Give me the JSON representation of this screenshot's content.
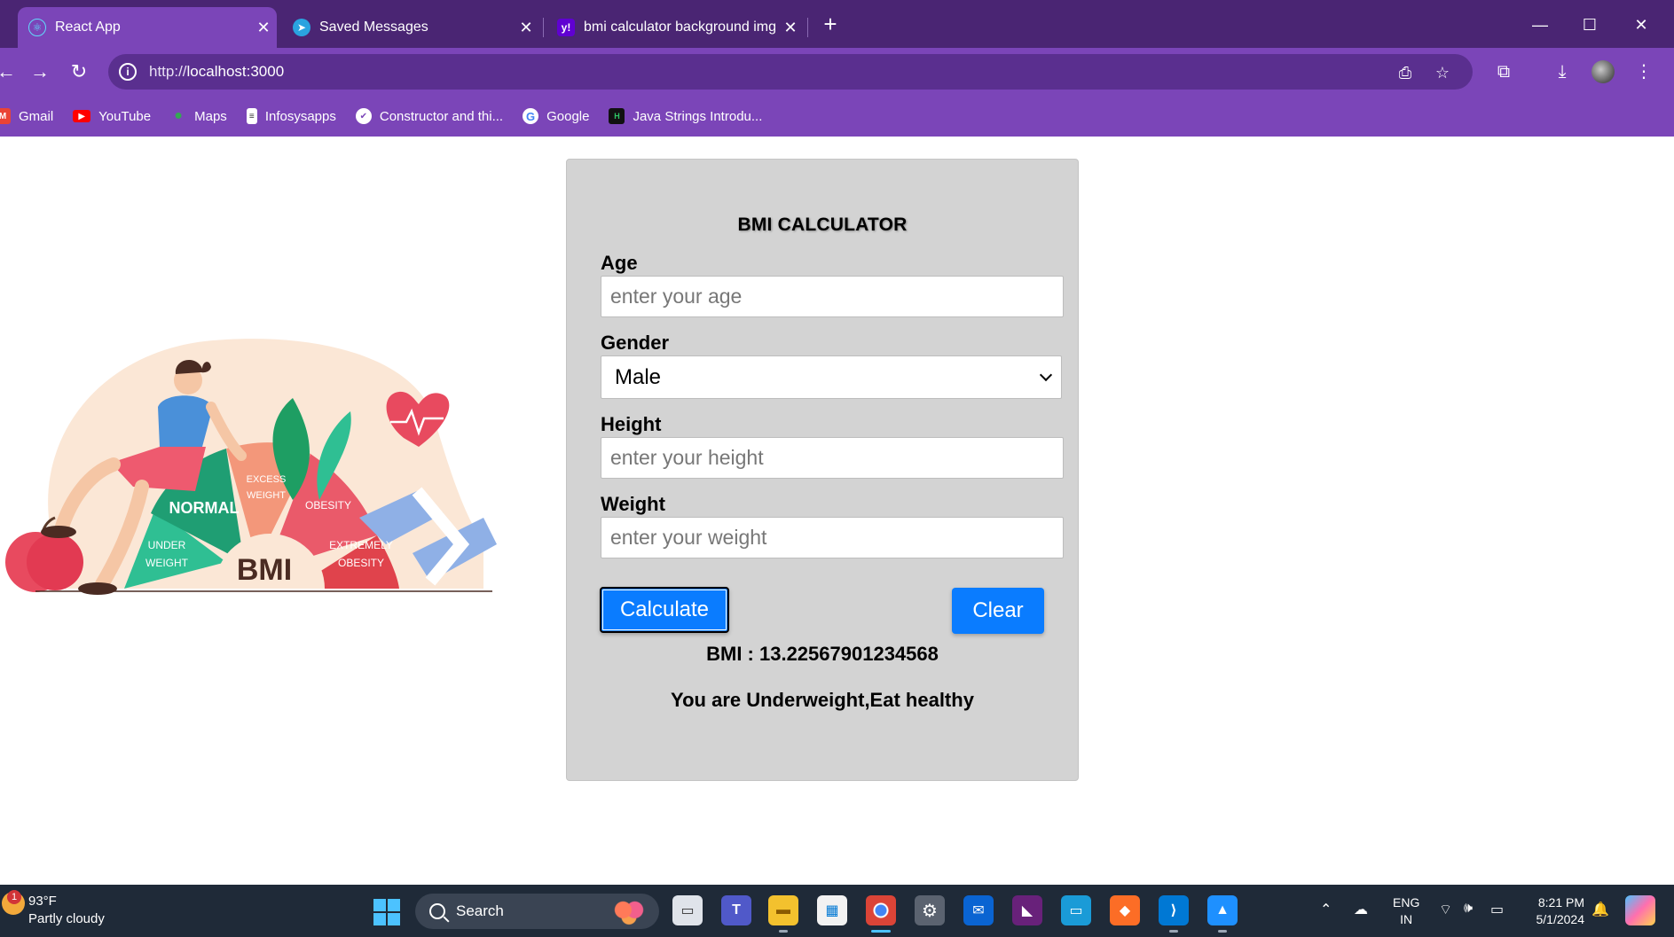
{
  "browser": {
    "tabs": [
      {
        "title": "React App",
        "active": true,
        "icon": "react-icon"
      },
      {
        "title": "Saved Messages",
        "active": false,
        "icon": "telegram-icon"
      },
      {
        "title": "bmi calculator background img",
        "active": false,
        "icon": "yahoo-icon"
      }
    ],
    "new_tab_label": "+",
    "url_prefix": "http://",
    "url_host": "localhost:3000",
    "bookmarks": [
      {
        "label": "Gmail",
        "icon": "gmail-icon"
      },
      {
        "label": "YouTube",
        "icon": "youtube-icon"
      },
      {
        "label": "Maps",
        "icon": "maps-icon"
      },
      {
        "label": "Infosysapps",
        "icon": "document-icon"
      },
      {
        "label": "Constructor and thi...",
        "icon": "check-circle-icon"
      },
      {
        "label": "Google",
        "icon": "google-icon"
      },
      {
        "label": "Java Strings Introdu...",
        "icon": "hackerrank-icon"
      }
    ]
  },
  "illustration": {
    "segments": [
      "UNDER WEIGHT",
      "NORMAL",
      "EXCESS WEIGHT",
      "OBESITY",
      "EXTREMELY OBESITY"
    ],
    "center_label": "BMI"
  },
  "form": {
    "title": "BMI CALCULATOR",
    "age_label": "Age",
    "age_placeholder": "enter your age",
    "gender_label": "Gender",
    "gender_value": "Male",
    "height_label": "Height",
    "height_placeholder": "enter your height",
    "weight_label": "Weight",
    "weight_placeholder": "enter your weight",
    "calculate_label": "Calculate",
    "clear_label": "Clear",
    "bmi_result": "BMI : 13.22567901234568",
    "message": "You are Underweight,Eat healthy"
  },
  "taskbar": {
    "temperature": "93°F",
    "condition": "Partly cloudy",
    "search_label": "Search",
    "lang_line1": "ENG",
    "lang_line2": "IN",
    "time": "8:21 PM",
    "date": "5/1/2024",
    "weather_badge": "1"
  },
  "colors": {
    "chrome_tabbar": "#4a2573",
    "chrome_toolbar": "#7b45b8",
    "card_bg": "#d3d3d3",
    "button_blue": "#0a7cff",
    "taskbar": "#1f2a38"
  }
}
